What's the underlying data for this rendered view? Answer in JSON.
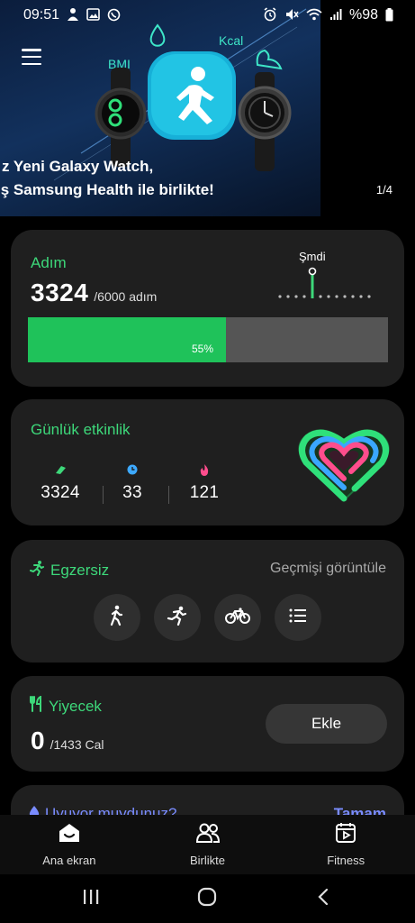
{
  "status_bar": {
    "time": "09:51",
    "battery": "%98",
    "left_icons": [
      "person-alert-icon",
      "image-icon",
      "whatsapp-icon"
    ],
    "right_icons": [
      "alarm-icon",
      "mute-icon",
      "wifi-icon",
      "signal-icon",
      "battery-icon"
    ]
  },
  "banner": {
    "line1": "z Yeni Galaxy Watch,",
    "line2": "ış Samsung Health ile birlikte!",
    "page_indicator": "1/4",
    "label_bmi": "BMI",
    "label_kcal": "Kcal"
  },
  "steps": {
    "title": "Adım",
    "count": "3324",
    "goal": "/6000 adım",
    "now_label": "Şmdi",
    "percent": "55%",
    "progress": 0.55
  },
  "activity": {
    "title": "Günlük etkinlik",
    "stats": [
      {
        "icon": "shoe-icon",
        "value": "3324",
        "color": "#3dd87a"
      },
      {
        "icon": "clock-icon",
        "value": "33",
        "color": "#3da9ff"
      },
      {
        "icon": "flame-icon",
        "value": "121",
        "color": "#ff4d8d"
      }
    ]
  },
  "exercise": {
    "title": "Egzersiz",
    "history_label": "Geçmişi görüntüle",
    "buttons": [
      "walk-icon",
      "run-icon",
      "bike-icon",
      "list-icon"
    ]
  },
  "food": {
    "title": "Yiyecek",
    "count": "0",
    "goal": "/1433 Cal",
    "add_label": "Ekle"
  },
  "sleep": {
    "title": "Uyuyor muydunuz?",
    "action": "Tamam"
  },
  "bottom_nav": {
    "items": [
      {
        "label": "Ana ekran",
        "icon": "home-icon"
      },
      {
        "label": "Birlikte",
        "icon": "people-icon"
      },
      {
        "label": "Fitness",
        "icon": "fitness-icon"
      }
    ]
  },
  "colors": {
    "accent_green": "#3dd87a",
    "progress_green": "#1fc25a",
    "card_bg": "#1f1f1f"
  }
}
